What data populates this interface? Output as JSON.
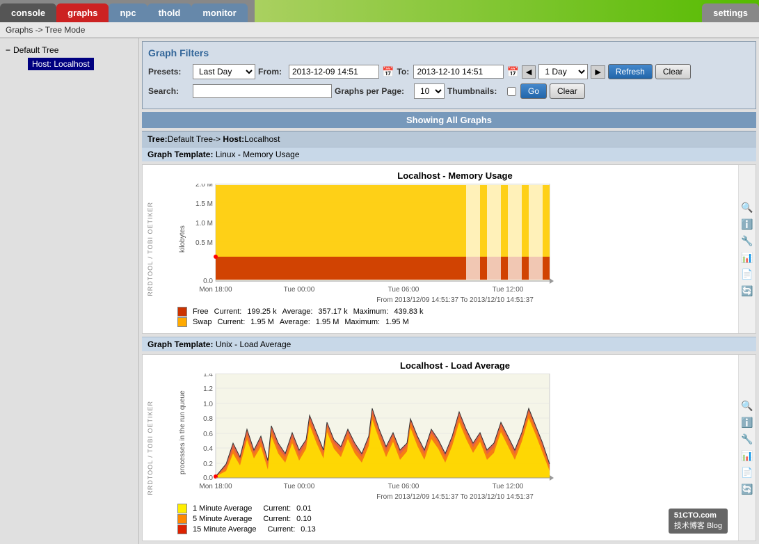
{
  "nav": {
    "tabs": [
      {
        "id": "console",
        "label": "console",
        "active": false
      },
      {
        "id": "graphs",
        "label": "graphs",
        "active": true
      },
      {
        "id": "npc",
        "label": "npc",
        "active": false
      },
      {
        "id": "thold",
        "label": "thold",
        "active": false
      },
      {
        "id": "monitor",
        "label": "monitor",
        "active": false
      },
      {
        "id": "settings",
        "label": "settings",
        "active": false
      }
    ]
  },
  "breadcrumb": "Graphs -> Tree Mode",
  "sidebar": {
    "tree_label": "Default Tree",
    "host_label": "Host: Localhost"
  },
  "graph_filters": {
    "title": "Graph Filters",
    "presets_label": "Presets:",
    "presets_value": "Last Day",
    "from_label": "From:",
    "from_value": "2013-12-09 14:51",
    "to_label": "To:",
    "to_value": "2013-12-10 14:51",
    "timespan_value": "1 Day",
    "refresh_label": "Refresh",
    "clear_label": "Clear",
    "search_label": "Search:",
    "graphs_per_page_label": "Graphs per Page:",
    "graphs_per_page_value": "10",
    "thumbnails_label": "Thumbnails:",
    "go_label": "Go",
    "clear2_label": "Clear"
  },
  "showing_bar": "Showing All Graphs",
  "tree_header": {
    "tree_text": "Tree:",
    "tree_name": "Default Tree->",
    "host_text": "Host:",
    "host_name": "Localhost"
  },
  "graph_template_1": {
    "label_text": "Graph Template:",
    "label_name": "Linux - Memory Usage"
  },
  "memory_graph": {
    "title": "Localhost - Memory Usage",
    "y_axis_label": "kilobytes",
    "x_labels": [
      "Mon 18:00",
      "Tue 00:00",
      "Tue 06:00",
      "Tue 12:00"
    ],
    "y_labels": [
      "2.0 M",
      "1.5 M",
      "1.0 M",
      "0.5 M",
      "0.0"
    ],
    "from_to": "From 2013/12/09 14:51:37 To 2013/12/10 14:51:37",
    "legend": [
      {
        "color": "#cc3300",
        "name": "Free",
        "current": "199.25 k",
        "average": "357.17 k",
        "maximum": "439.83 k"
      },
      {
        "color": "#ffaa00",
        "name": "Swap",
        "current": "1.95 M",
        "average": "1.95 M",
        "maximum": "1.95 M"
      }
    ],
    "rotated_text": "RRDTOOL / TOBI OETIKER"
  },
  "graph_template_2": {
    "label_text": "Graph Template:",
    "label_name": "Unix - Load Average"
  },
  "load_graph": {
    "title": "Localhost - Load Average",
    "y_axis_label": "processes in the run queue",
    "x_labels": [
      "Mon 18:00",
      "Tue 00:00",
      "Tue 06:00",
      "Tue 12:00"
    ],
    "y_labels": [
      "1.4",
      "1.2",
      "1.0",
      "0.8",
      "0.6",
      "0.4",
      "0.2",
      "0.0"
    ],
    "from_to": "From 2013/12/09 14:51:37 To 2013/12/10 14:51:37",
    "legend": [
      {
        "color": "#ffee00",
        "name": "1 Minute Average",
        "current": "0.01"
      },
      {
        "color": "#ff8800",
        "name": "5 Minute Average",
        "current": "0.10"
      },
      {
        "color": "#dd2200",
        "name": "15 Minute Average",
        "current": "0.13"
      }
    ],
    "rotated_text": "RRDTOOL / TOBI OETIKER"
  },
  "icons": {
    "zoom_in": "🔍",
    "zoom_out": "🔍",
    "wrench": "🔧",
    "bar_chart": "📊",
    "page": "📄",
    "refresh": "🔄"
  },
  "watermark": {
    "site": "51CTO.com",
    "label": "技术博客 Blog"
  }
}
